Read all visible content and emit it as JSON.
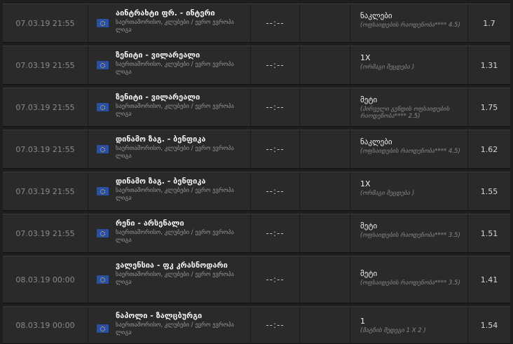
{
  "rows": [
    {
      "date": "07.03.19 21:55",
      "teams": "აინტრახტი ფრ. - ინტერი",
      "league": "საერთაშორისო, კლუბები / ევრო ევროპა ლიგა",
      "score": "--:--",
      "bet": "ნაკლები",
      "bet_detail": "(ოფსაიდების რაოდენობა**** 4.5)",
      "odd": "1.7"
    },
    {
      "date": "07.03.19 21:55",
      "teams": "ზენიტი - ვილარეალი",
      "league": "საერთაშორისო, კლუბები / ევრო ევროპა ლიგა",
      "score": "--:--",
      "bet": "1X",
      "bet_detail": "(ორმაგი შეცდება )",
      "odd": "1.31"
    },
    {
      "date": "07.03.19 21:55",
      "teams": "ზენიტი - ვილარეალი",
      "league": "საერთაშორისო, კლუბები / ევრო ევროპა ლიგა",
      "score": "--:--",
      "bet": "მეტი",
      "bet_detail": "(პირველი გუნდის ოფსაიდების რაოდენობა**** 2.5)",
      "odd": "1.75"
    },
    {
      "date": "07.03.19 21:55",
      "teams": "დინამო ზაგ. - ბენფიკა",
      "league": "საერთაშორისო, კლუბები / ევრო ევროპა ლიგა",
      "score": "--:--",
      "bet": "ნაკლები",
      "bet_detail": "(ოფსაიდების რაოდენობა**** 4.5)",
      "odd": "1.62"
    },
    {
      "date": "07.03.19 21:55",
      "teams": "დინამო ზაგ. - ბენფიკა",
      "league": "საერთაშორისო, კლუბები / ევრო ევროპა ლიგა",
      "score": "--:--",
      "bet": "1X",
      "bet_detail": "(ორმაგი შეცდება )",
      "odd": "1.55"
    },
    {
      "date": "07.03.19 21:55",
      "teams": "რენი - არსენალი",
      "league": "საერთაშორისო, კლუბები / ევრო ევროპა ლიგა",
      "score": "--:--",
      "bet": "მეტი",
      "bet_detail": "(ოფსაიდების რაოდენობა**** 3.5)",
      "odd": "1.51"
    },
    {
      "date": "08.03.19 00:00",
      "teams": "ვალენსია - ფკ კრასნოდარი",
      "league": "საერთაშორისო, კლუბები / ევრო ევროპა ლიგა",
      "score": "--:--",
      "bet": "მეტი",
      "bet_detail": "(ოფსაიდების რაოდენობა**** 3.5)",
      "odd": "1.41"
    },
    {
      "date": "08.03.19 00:00",
      "teams": "ნაპოლი - ზალცბურგი",
      "league": "საერთაშორისო, კლუბები / ევრო ევროპა ლიგა",
      "score": "--:--",
      "bet": "1",
      "bet_detail": "(მატჩის შედეგი 1 X 2 )",
      "odd": "1.54"
    }
  ]
}
